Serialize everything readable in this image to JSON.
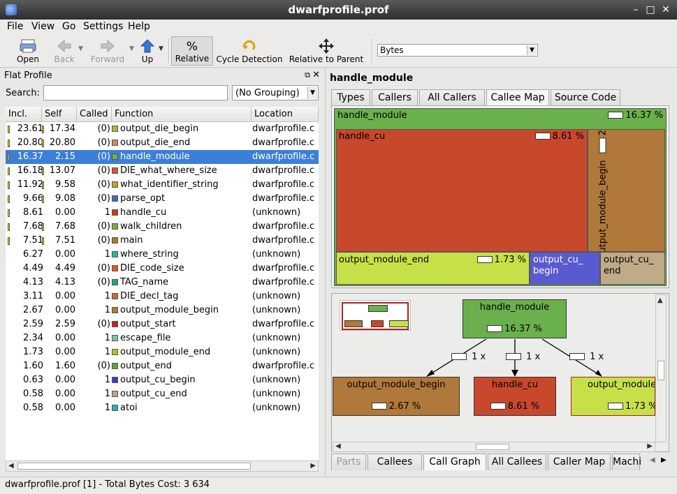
{
  "window": {
    "title": "dwarfprofile.prof"
  },
  "menu": [
    "File",
    "View",
    "Go",
    "Settings",
    "Help"
  ],
  "toolbar": {
    "open": "Open",
    "back": "Back",
    "forward": "Forward",
    "up": "Up",
    "relative_symbol": "%",
    "relative": "Relative",
    "cycle": "Cycle Detection",
    "relative_parent": "Relative to Parent",
    "event_type": "Bytes"
  },
  "flat_profile": {
    "title": "Flat Profile",
    "search_label": "Search:",
    "search_value": "",
    "grouping": "(No Grouping)",
    "columns": [
      "Incl.",
      "Self",
      "Called",
      "Function",
      "Location"
    ],
    "rows": [
      {
        "incl": "23.61",
        "self": "17.34",
        "called": "(0)",
        "func": "output_die_begin",
        "loc": "dwarfprofile.c",
        "color": "#9ebd3e",
        "ib": true,
        "sb": true
      },
      {
        "incl": "20.80",
        "self": "20.80",
        "called": "(0)",
        "func": "output_die_end",
        "loc": "dwarfprofile.c",
        "color": "#c8895a",
        "ib": true,
        "sb": true
      },
      {
        "incl": "16.37",
        "self": "2.15",
        "called": "(0)",
        "func": "handle_module",
        "loc": "dwarfprofile.c",
        "color": "#6ab04c",
        "ib": true,
        "sb": false
      },
      {
        "incl": "16.18",
        "self": "13.07",
        "called": "(0)",
        "func": "DIE_what_where_size",
        "loc": "dwarfprofile.c",
        "color": "#d35a2a",
        "ib": true,
        "sb": true
      },
      {
        "incl": "11.92",
        "self": "9.58",
        "called": "(0)",
        "func": "what_identifier_string",
        "loc": "dwarfprofile.c",
        "color": "#c8a020",
        "ib": true,
        "sb": true
      },
      {
        "incl": "9.66",
        "self": "9.08",
        "called": "(0)",
        "func": "parse_opt",
        "loc": "dwarfprofile.c",
        "color": "#3a6fc0",
        "ib": true,
        "sb": true
      },
      {
        "incl": "8.61",
        "self": "0.00",
        "called": "1",
        "func": "handle_cu",
        "loc": "(unknown)",
        "color": "#c53a1f",
        "ib": true,
        "sb": false
      },
      {
        "incl": "7.68",
        "self": "7.68",
        "called": "(0)",
        "func": "walk_children",
        "loc": "dwarfprofile.c",
        "color": "#7fb02c",
        "ib": true,
        "sb": true
      },
      {
        "incl": "7.51",
        "self": "7.51",
        "called": "(0)",
        "func": "main",
        "loc": "dwarfprofile.c",
        "color": "#a57a25",
        "ib": true,
        "sb": true
      },
      {
        "incl": "6.27",
        "self": "0.00",
        "called": "1",
        "func": "where_string",
        "loc": "(unknown)",
        "color": "#25b5a5",
        "ib": false,
        "sb": false
      },
      {
        "incl": "4.49",
        "self": "4.49",
        "called": "(0)",
        "func": "DIE_code_size",
        "loc": "dwarfprofile.c",
        "color": "#d3602a",
        "ib": false,
        "sb": false
      },
      {
        "incl": "4.13",
        "self": "4.13",
        "called": "(0)",
        "func": "TAG_name",
        "loc": "dwarfprofile.c",
        "color": "#22a875",
        "ib": false,
        "sb": false
      },
      {
        "incl": "3.11",
        "self": "0.00",
        "called": "1",
        "func": "DIE_decl_tag",
        "loc": "(unknown)",
        "color": "#c86a20",
        "ib": false,
        "sb": false
      },
      {
        "incl": "2.67",
        "self": "0.00",
        "called": "1",
        "func": "output_module_begin",
        "loc": "(unknown)",
        "color": "#b0783a",
        "ib": false,
        "sb": false
      },
      {
        "incl": "2.59",
        "self": "2.59",
        "called": "(0)",
        "func": "output_start",
        "loc": "dwarfprofile.c",
        "color": "#c8201a",
        "ib": false,
        "sb": false
      },
      {
        "incl": "2.34",
        "self": "0.00",
        "called": "1",
        "func": "escape_file",
        "loc": "(unknown)",
        "color": "#7cc8a0",
        "ib": false,
        "sb": false
      },
      {
        "incl": "1.73",
        "self": "0.00",
        "called": "1",
        "func": "output_module_end",
        "loc": "(unknown)",
        "color": "#a8c820",
        "ib": false,
        "sb": false
      },
      {
        "incl": "1.60",
        "self": "1.60",
        "called": "(0)",
        "func": "output_end",
        "loc": "dwarfprofile.c",
        "color": "#5aa53a",
        "ib": false,
        "sb": false
      },
      {
        "incl": "0.63",
        "self": "0.00",
        "called": "1",
        "func": "output_cu_begin",
        "loc": "(unknown)",
        "color": "#3a3ac8",
        "ib": false,
        "sb": false
      },
      {
        "incl": "0.58",
        "self": "0.00",
        "called": "1",
        "func": "output_cu_end",
        "loc": "(unknown)",
        "color": "#b8a488",
        "ib": false,
        "sb": false
      },
      {
        "incl": "0.58",
        "self": "0.00",
        "called": "1",
        "func": "atoi",
        "loc": "(unknown)",
        "color": "#25b5a5",
        "ib": false,
        "sb": false
      }
    ]
  },
  "detail": {
    "function": "handle_module",
    "tabs_top": [
      "Types",
      "Callers",
      "All Callers",
      "Callee Map",
      "Source Code"
    ],
    "active_top": "Callee Map",
    "map": {
      "root": {
        "name": "handle_module",
        "pct": "16.37 %"
      },
      "handle_cu": {
        "name": "handle_cu",
        "pct": "8.61 %"
      },
      "omb": {
        "name": "output_module_begin",
        "pct": "2.67 %"
      },
      "ome": {
        "name": "output_module_end",
        "pct": "1.73 %"
      },
      "ocb": {
        "name": "output_cu_\nbegin"
      },
      "oce": {
        "name": "output_cu_\nend"
      }
    },
    "graph": {
      "root": {
        "name": "handle_module",
        "pct": "16.37 %"
      },
      "edges": [
        "1 x",
        "1 x",
        "1 x"
      ],
      "n1": {
        "name": "output_module_begin",
        "pct": "2.67 %"
      },
      "n2": {
        "name": "handle_cu",
        "pct": "8.61 %"
      },
      "n3": {
        "name": "output_module",
        "pct": "1.73 %"
      }
    },
    "tabs_bottom": [
      "Parts",
      "Callees",
      "Call Graph",
      "All Callees",
      "Caller Map",
      "Machi"
    ],
    "active_bottom": "Call Graph"
  },
  "status": "dwarfprofile.prof [1] - Total Bytes Cost:  3 634"
}
